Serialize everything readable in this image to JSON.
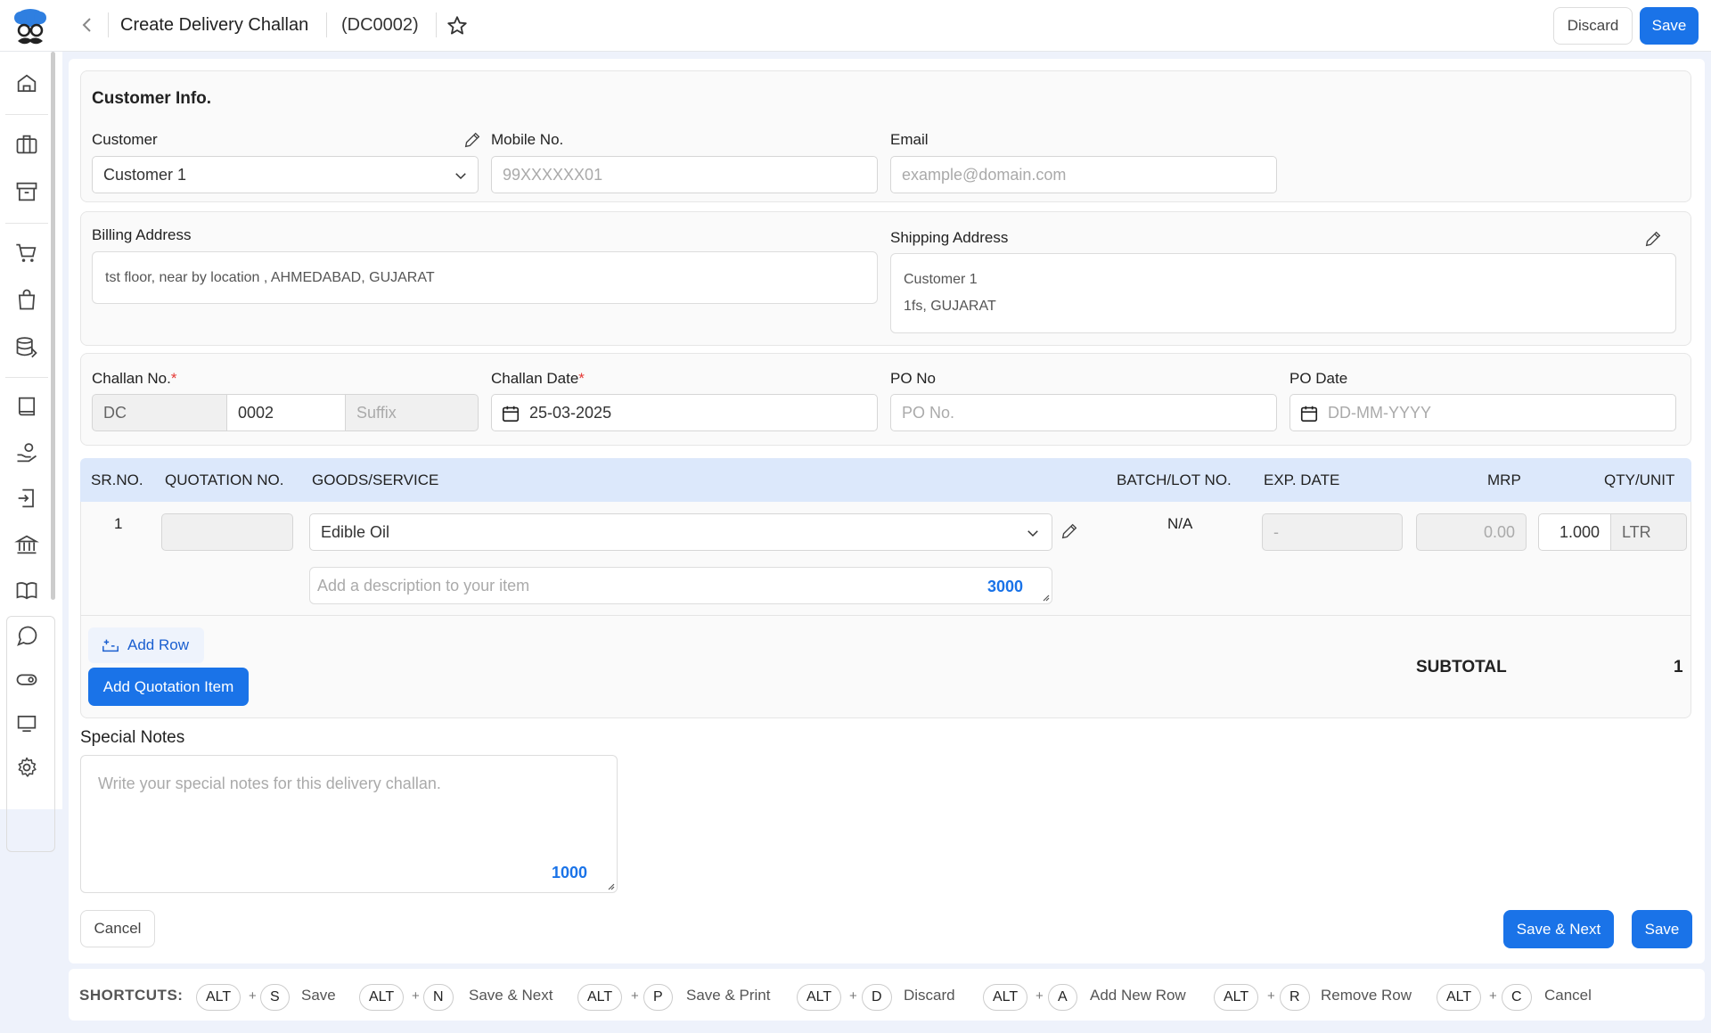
{
  "header": {
    "title": "Create Delivery Challan",
    "doc_no": "(DC0002)",
    "discard_label": "Discard",
    "save_label": "Save"
  },
  "sidebar": {
    "items": [
      "home-icon",
      "briefcase-icon",
      "archive-icon",
      "cart-icon",
      "bag-icon",
      "database-icon",
      "book-icon",
      "hand-coin-icon",
      "receipt-icon",
      "bank-icon",
      "open-book-icon",
      "chat-icon",
      "toggle-icon",
      "monitor-icon",
      "gear-icon"
    ]
  },
  "customer_info": {
    "title": "Customer Info.",
    "customer_label": "Customer",
    "customer_value": "Customer 1",
    "mobile_label": "Mobile No.",
    "mobile_placeholder": "99XXXXXX01",
    "email_label": "Email",
    "email_placeholder": "example@domain.com"
  },
  "address": {
    "billing_label": "Billing Address",
    "billing_value": "tst floor, near by location , AHMEDABAD, GUJARAT",
    "shipping_label": "Shipping Address",
    "shipping_line1": "Customer 1",
    "shipping_line2": "1fs, GUJARAT"
  },
  "challan": {
    "no_label": "Challan No.",
    "prefix": "DC",
    "number": "0002",
    "suffix_placeholder": "Suffix",
    "date_label": "Challan Date",
    "date_value": "25-03-2025",
    "po_no_label": "PO No",
    "po_no_placeholder": "PO No.",
    "po_date_label": "PO Date",
    "po_date_placeholder": "DD-MM-YYYY",
    "required_mark": "*"
  },
  "table": {
    "headers": {
      "sr": "SR.NO.",
      "quotation": "QUOTATION NO.",
      "goods": "GOODS/SERVICE",
      "batch": "BATCH/LOT NO.",
      "exp": "EXP. DATE",
      "mrp": "MRP",
      "qty": "QTY/UNIT"
    },
    "rows": [
      {
        "sr": "1",
        "goods": "Edible Oil",
        "description_placeholder": "Add a description to your item",
        "description_counter": "3000",
        "batch": "N/A",
        "exp": "-",
        "mrp": "0.00",
        "qty": "1.000",
        "unit": "LTR"
      }
    ],
    "add_row_label": "Add Row",
    "add_quotation_label": "Add Quotation Item",
    "subtotal_label": "SUBTOTAL",
    "subtotal_value": "1"
  },
  "notes": {
    "label": "Special Notes",
    "placeholder": "Write your special notes for this delivery challan.",
    "counter": "1000"
  },
  "footer": {
    "cancel_label": "Cancel",
    "save_next_label": "Save & Next",
    "save_label": "Save"
  },
  "shortcuts": {
    "title": "SHORTCUTS:",
    "items": [
      {
        "mod": "ALT",
        "key": "S",
        "label": "Save"
      },
      {
        "mod": "ALT",
        "key": "N",
        "label": "Save & Next"
      },
      {
        "mod": "ALT",
        "key": "P",
        "label": "Save & Print"
      },
      {
        "mod": "ALT",
        "key": "D",
        "label": "Discard"
      },
      {
        "mod": "ALT",
        "key": "A",
        "label": "Add New Row"
      },
      {
        "mod": "ALT",
        "key": "R",
        "label": "Remove Row"
      },
      {
        "mod": "ALT",
        "key": "C",
        "label": "Cancel"
      }
    ],
    "plus": "+"
  },
  "colors": {
    "accent": "#1a73e8",
    "table_header": "#dce8fb",
    "required": "#e53935"
  }
}
